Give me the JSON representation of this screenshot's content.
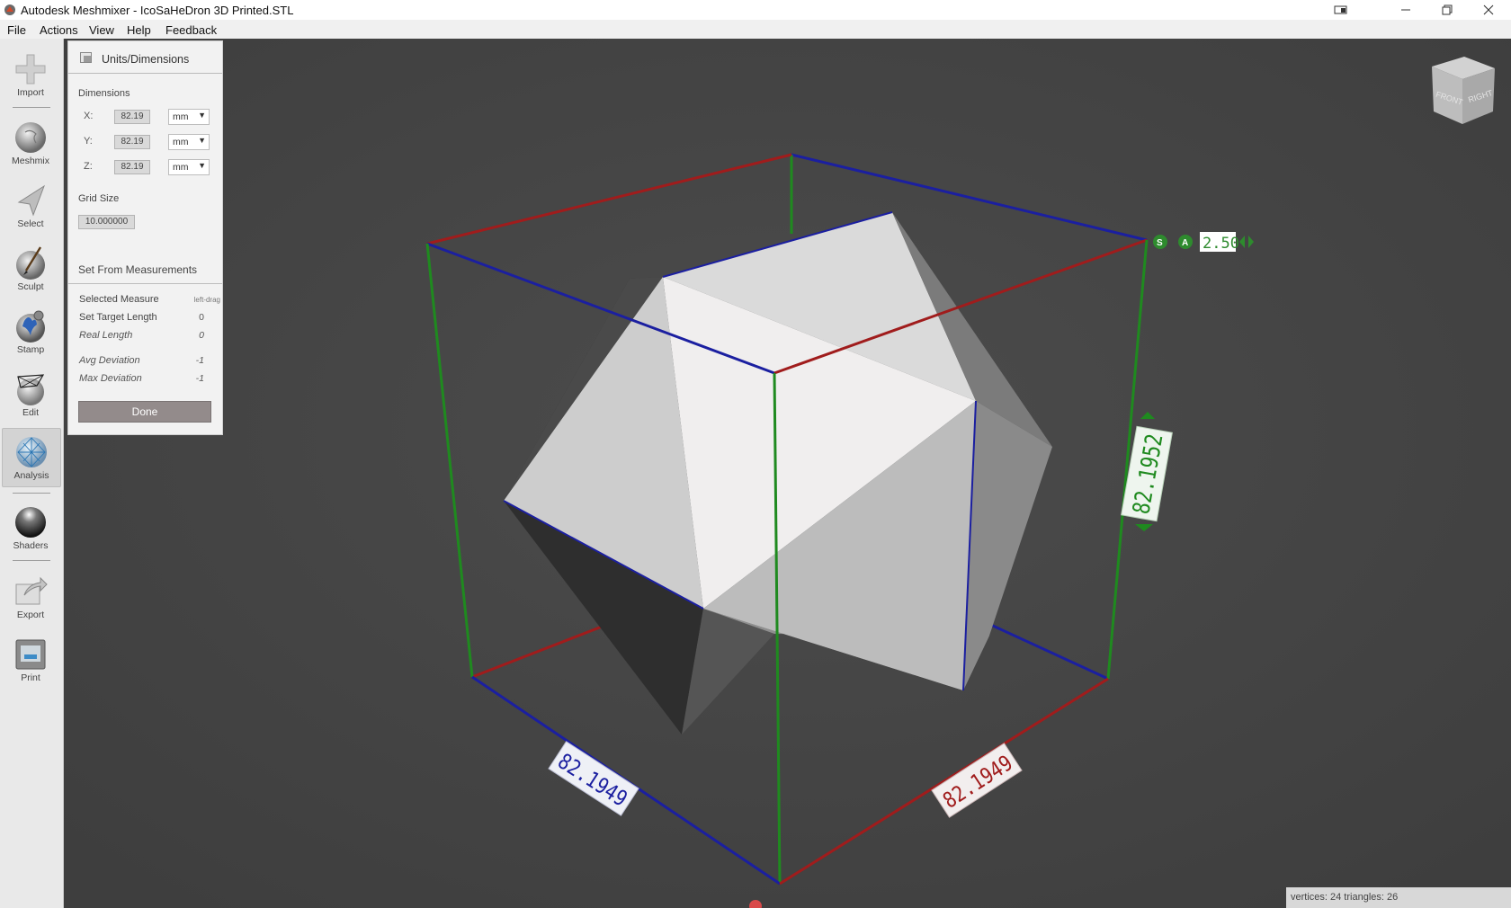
{
  "window": {
    "title": "Autodesk Meshmixer - IcoSaHeDron 3D Printed.STL"
  },
  "menu": [
    "File",
    "Actions",
    "View",
    "Help",
    "Feedback"
  ],
  "tools": [
    {
      "label": "Import",
      "icon": "import-icon"
    },
    {
      "label": "Meshmix",
      "icon": "meshmix-icon"
    },
    {
      "label": "Select",
      "icon": "select-icon"
    },
    {
      "label": "Sculpt",
      "icon": "sculpt-icon"
    },
    {
      "label": "Stamp",
      "icon": "stamp-icon"
    },
    {
      "label": "Edit",
      "icon": "edit-icon"
    },
    {
      "label": "Analysis",
      "icon": "analysis-icon",
      "active": true
    },
    {
      "label": "Shaders",
      "icon": "shaders-icon"
    },
    {
      "label": "Export",
      "icon": "export-icon"
    },
    {
      "label": "Print",
      "icon": "print-icon"
    }
  ],
  "panel": {
    "title": "Units/Dimensions",
    "dimensions_label": "Dimensions",
    "dims": [
      {
        "axis": "X:",
        "value": "82.19",
        "unit": "mm"
      },
      {
        "axis": "Y:",
        "value": "82.19",
        "unit": "mm"
      },
      {
        "axis": "Z:",
        "value": "82.19",
        "unit": "mm"
      }
    ],
    "grid_size_label": "Grid Size",
    "grid_size_value": "10.000000",
    "set_from_label": "Set From Measurements",
    "selected_measure_label": "Selected Measure",
    "selected_measure_hint": "left-drag",
    "set_target_length_label": "Set Target Length",
    "set_target_length_value": "0",
    "real_length_label": "Real Length",
    "real_length_value": "0",
    "avg_deviation_label": "Avg Deviation",
    "avg_deviation_value": "-1",
    "max_deviation_label": "Max Deviation",
    "max_deviation_value": "-1",
    "done_label": "Done"
  },
  "viewport": {
    "view_cube": {
      "front": "FRONT",
      "right": "RIGHT"
    },
    "scale_controls": {
      "s_label": "S",
      "a_label": "A",
      "value": "2.50"
    },
    "dim_labels": {
      "x": "82.1949",
      "y": "82.1949",
      "z": "82.1952"
    },
    "colors": {
      "x_axis": "#a01c1c",
      "y_axis": "#1b1fa0",
      "z_axis": "#1f8a1f"
    }
  },
  "status": {
    "text": "vertices: 24 triangles: 26"
  }
}
